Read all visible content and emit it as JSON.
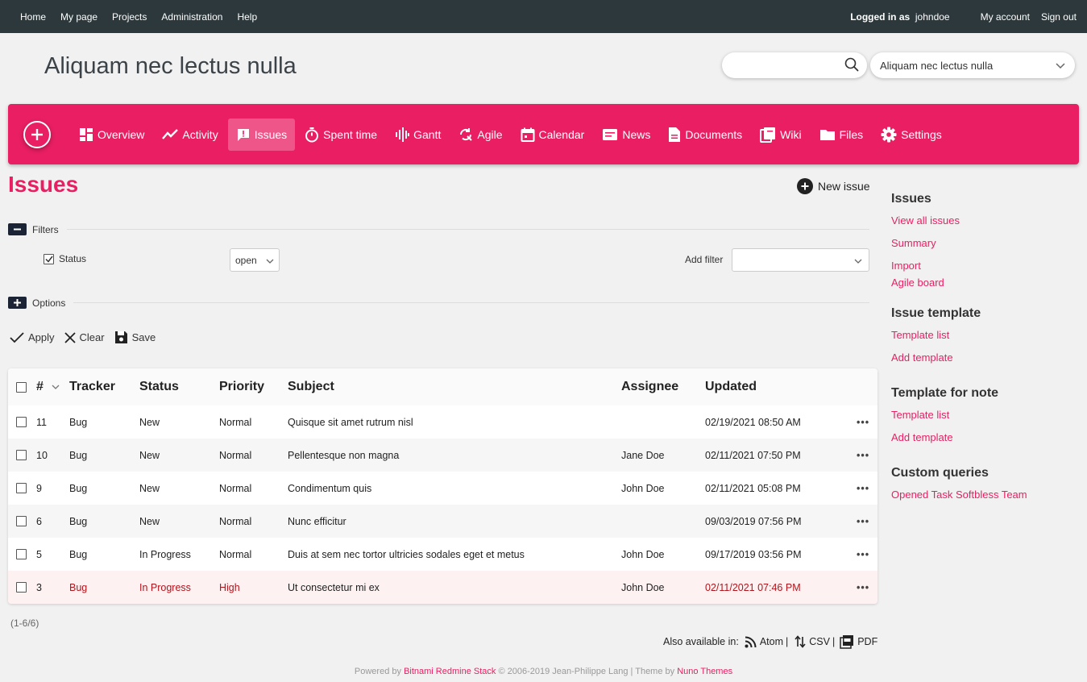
{
  "topbar": {
    "nav": [
      "Home",
      "My page",
      "Projects",
      "Administration",
      "Help"
    ],
    "logged_in_label": "Logged in as",
    "user": "johndoe",
    "my_account": "My account",
    "sign_out": "Sign out"
  },
  "header": {
    "title": "Aliquam nec lectus nulla",
    "search_placeholder": "",
    "project_selected": "Aliquam nec lectus nulla"
  },
  "menu": {
    "items": [
      {
        "label": "Overview",
        "icon": "overview-icon"
      },
      {
        "label": "Activity",
        "icon": "activity-icon"
      },
      {
        "label": "Issues",
        "icon": "issues-icon",
        "active": true
      },
      {
        "label": "Spent time",
        "icon": "stopwatch-icon"
      },
      {
        "label": "Gantt",
        "icon": "gantt-icon"
      },
      {
        "label": "Agile",
        "icon": "agile-icon"
      },
      {
        "label": "Calendar",
        "icon": "calendar-icon"
      },
      {
        "label": "News",
        "icon": "news-icon"
      },
      {
        "label": "Documents",
        "icon": "document-icon"
      },
      {
        "label": "Wiki",
        "icon": "wiki-icon"
      },
      {
        "label": "Files",
        "icon": "folder-icon"
      },
      {
        "label": "Settings",
        "icon": "gear-icon"
      }
    ]
  },
  "content": {
    "heading": "Issues",
    "new_issue": "New issue",
    "filters_label": "Filters",
    "status_label": "Status",
    "status_value": "open",
    "add_filter_label": "Add filter",
    "add_filter_value": "",
    "options_label": "Options",
    "apply": "Apply",
    "clear": "Clear",
    "save": "Save"
  },
  "table": {
    "headers": [
      "#",
      "Tracker",
      "Status",
      "Priority",
      "Subject",
      "Assignee",
      "Updated"
    ],
    "rows": [
      {
        "id": "11",
        "tracker": "Bug",
        "status": "New",
        "priority": "Normal",
        "subject": "Quisque sit amet rutrum nisl",
        "assignee": "",
        "updated": "02/19/2021 08:50 AM"
      },
      {
        "id": "10",
        "tracker": "Bug",
        "status": "New",
        "priority": "Normal",
        "subject": "Pellentesque non magna",
        "assignee": "Jane Doe",
        "updated": "02/11/2021 07:50 PM"
      },
      {
        "id": "9",
        "tracker": "Bug",
        "status": "New",
        "priority": "Normal",
        "subject": "Condimentum quis",
        "assignee": "John Doe",
        "updated": "02/11/2021 05:08 PM"
      },
      {
        "id": "6",
        "tracker": "Bug",
        "status": "New",
        "priority": "Normal",
        "subject": "Nunc efficitur",
        "assignee": "",
        "updated": "09/03/2019 07:56 PM"
      },
      {
        "id": "5",
        "tracker": "Bug",
        "status": "In Progress",
        "priority": "Normal",
        "subject": "Duis at sem nec tortor ultricies sodales eget et metus",
        "assignee": "John Doe",
        "updated": "09/17/2019 03:56 PM"
      },
      {
        "id": "3",
        "tracker": "Bug",
        "status": "In Progress",
        "priority": "High",
        "subject": "Ut consectetur mi ex",
        "assignee": "John Doe",
        "updated": "02/11/2021 07:46 PM"
      }
    ],
    "count": "(1-6/6)"
  },
  "formats": {
    "label": "Also available in:",
    "atom": "Atom",
    "csv": "CSV",
    "pdf": "PDF",
    "sep": "|"
  },
  "footer": {
    "powered_by": "Powered by",
    "stack": "Bitnami Redmine Stack",
    "copyright": "© 2006-2019 Jean-Philippe Lang | Theme by",
    "theme": "Nuno Themes"
  },
  "sidebar": {
    "issues_heading": "Issues",
    "view_all": "View all issues",
    "summary": "Summary",
    "import": "Import",
    "agile_board": "Agile board",
    "template_heading": "Issue template",
    "template_list": "Template list",
    "add_template": "Add template",
    "note_heading": "Template for note",
    "note_template_list": "Template list",
    "note_add_template": "Add template",
    "queries_heading": "Custom queries",
    "query_1": "Opened Task Softbless Team"
  },
  "colors": {
    "accent": "#e91e63",
    "topbar": "#2c383c",
    "high_priority": "#b0141c"
  }
}
